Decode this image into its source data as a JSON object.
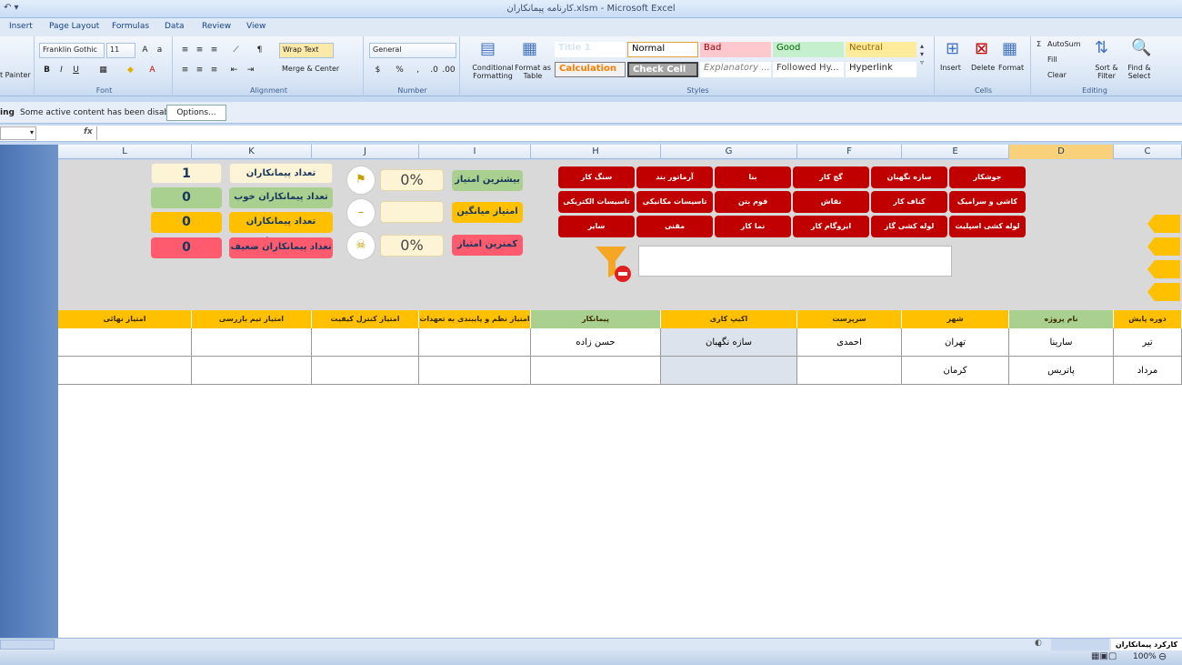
{
  "window": {
    "title": "کارنامه پیمانکاران.xlsm - Microsoft Excel"
  },
  "tabs": [
    "Insert",
    "Page Layout",
    "Formulas",
    "Data",
    "Review",
    "View"
  ],
  "ribbon": {
    "clipboard": {
      "painter": "t Painter"
    },
    "font": {
      "name": "Franklin Gothic",
      "size": "11",
      "label": "Font"
    },
    "alignment": {
      "wrap": "Wrap Text",
      "merge": "Merge & Center",
      "label": "Alignment"
    },
    "number": {
      "format": "General",
      "pct": "%",
      "comma": ",",
      "label": "Number"
    },
    "styles": {
      "conditional": "Conditional Formatting",
      "format_table": "Format as Table",
      "cells": [
        "Title 1",
        "Normal",
        "Bad",
        "Good",
        "Neutral",
        "Calculation",
        "Check Cell",
        "Explanatory ...",
        "Followed Hy...",
        "Hyperlink"
      ],
      "label": "Styles"
    },
    "cells": {
      "insert": "Insert",
      "delete": "Delete",
      "format": "Format",
      "label": "Cells"
    },
    "editing": {
      "autosum": "AutoSum",
      "fill": "Fill",
      "clear": "Clear",
      "sort": "Sort & Filter",
      "find": "Find & Select",
      "label": "Editing"
    }
  },
  "message_bar": {
    "prefix": "ing",
    "text": "Some active content has been disabled.",
    "options": "Options..."
  },
  "formula_bar": {
    "fx": "fx"
  },
  "columns": [
    "L",
    "K",
    "J",
    "I",
    "H",
    "G",
    "F",
    "E",
    "D",
    "C"
  ],
  "dashboard": {
    "counts": [
      {
        "label": "تعداد پیمانکاران",
        "value": "1"
      },
      {
        "label": "تعداد پیمانکاران خوب",
        "value": "0"
      },
      {
        "label": "تعداد پیمانکاران متوسط",
        "value": "0"
      },
      {
        "label": "تعداد پیمانکاران ضعیف",
        "value": "0"
      }
    ],
    "scores": [
      {
        "label": "بیشترین امتیاز",
        "value": "0%"
      },
      {
        "label": "امتیاز میانگین",
        "value": ""
      },
      {
        "label": "کمترین امتیاز",
        "value": "0%"
      }
    ],
    "categories": [
      "جوشکار",
      "سازه نگهبان",
      "گچ کار",
      "بنا",
      "آرماتور بند",
      "سنگ کار",
      "کاشی و سرامیک",
      "کناف کار",
      "نقاش",
      "فوم بتن",
      "تاسیسات مکانیکی",
      "تاسیسات الکتریکی",
      "لوله کشی اسپلیت",
      "لوله کشی گاز",
      "ایزوگام کار",
      "نما کار",
      "مقنی",
      "سایر"
    ],
    "search_value": ""
  },
  "table": {
    "headers": [
      "امتیاز نهائی",
      "امتیاز تیم بازرسی",
      "امتیاز کنترل کیفیت",
      "امتیاز نظم و پایبندی به تعهدات",
      "پیمانکار",
      "اکیپ کاری",
      "سرپرست",
      "شهر",
      "نام پروژه",
      "دوره پایش"
    ],
    "rows": [
      [
        "",
        "",
        "",
        "",
        "حسن زاده",
        "سازه نگهبان",
        "احمدی",
        "تهران",
        "سارینا",
        "تیر"
      ],
      [
        "",
        "",
        "",
        "",
        "",
        "",
        "",
        "کرمان",
        "پاتریس",
        "مرداد"
      ]
    ]
  },
  "sheet_tab": "کارکرد پیمانکاران",
  "status": {
    "zoom": "100%"
  },
  "colors": {
    "accent": "#ffc000",
    "category": "#c00000",
    "good": "#a9d08e",
    "bad": "#ff5b6e"
  }
}
